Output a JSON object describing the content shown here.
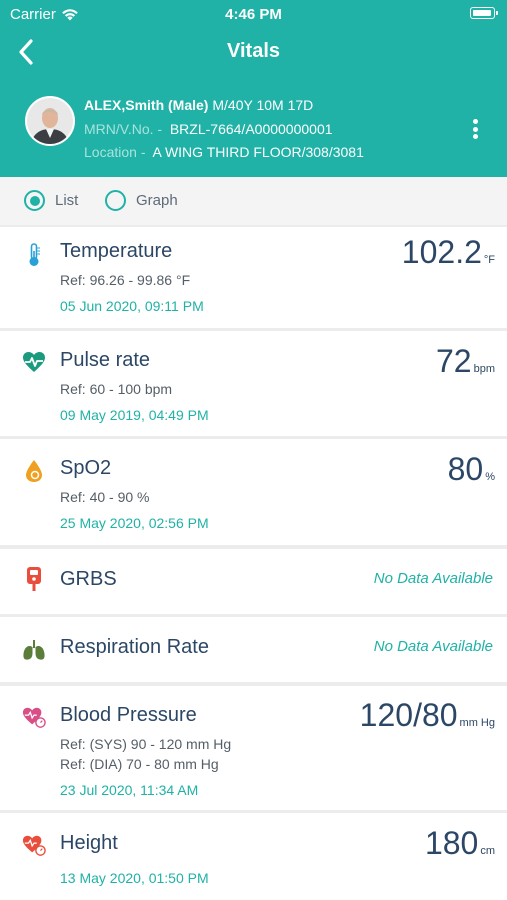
{
  "status_bar": {
    "carrier": "Carrier",
    "time": "4:46 PM"
  },
  "nav": {
    "title": "Vitals"
  },
  "patient": {
    "name": "ALEX,Smith (Male)",
    "age": "M/40Y 10M 17D",
    "mrn_label": "MRN/V.No. -",
    "mrn_value": "BRZL-7664/A0000000001",
    "location_label": "Location -",
    "location_value": "A WING THIRD FLOOR/308/3081"
  },
  "view_toggle": {
    "list_label": "List",
    "graph_label": "Graph",
    "selected": "List"
  },
  "vitals": [
    {
      "name": "Temperature",
      "value": "102.2",
      "unit": "°F",
      "ref": "Ref: 96.26 - 99.86 °F",
      "date": "05 Jun 2020, 09:11 PM",
      "icon": "thermometer-icon"
    },
    {
      "name": "Pulse rate",
      "value": "72",
      "unit": "bpm",
      "ref": "Ref: 60 - 100 bpm",
      "date": "09 May 2019, 04:49 PM",
      "icon": "heart-pulse-icon"
    },
    {
      "name": "SpO2",
      "value": "80",
      "unit": "%",
      "ref": "Ref: 40 - 90 %",
      "date": "25 May 2020, 02:56 PM",
      "icon": "oxygen-drop-icon"
    },
    {
      "name": "GRBS",
      "no_data": "No Data Available",
      "icon": "glucose-meter-icon"
    },
    {
      "name": "Respiration Rate",
      "no_data": "No Data Available",
      "icon": "lungs-icon"
    },
    {
      "name": "Blood Pressure",
      "value": "120/80",
      "unit": "mm Hg",
      "ref": "Ref: (SYS) 90 - 120 mm Hg",
      "ref2": "Ref: (DIA) 70 - 80 mm Hg",
      "date": "23 Jul 2020, 11:34 AM",
      "icon": "blood-pressure-icon"
    },
    {
      "name": "Height",
      "value": "180",
      "unit": "cm",
      "date": "13 May 2020, 01:50 PM",
      "icon": "height-icon"
    }
  ],
  "colors": {
    "accent": "#20b2a6",
    "title_text": "#2c4766",
    "background": "#ececec"
  }
}
